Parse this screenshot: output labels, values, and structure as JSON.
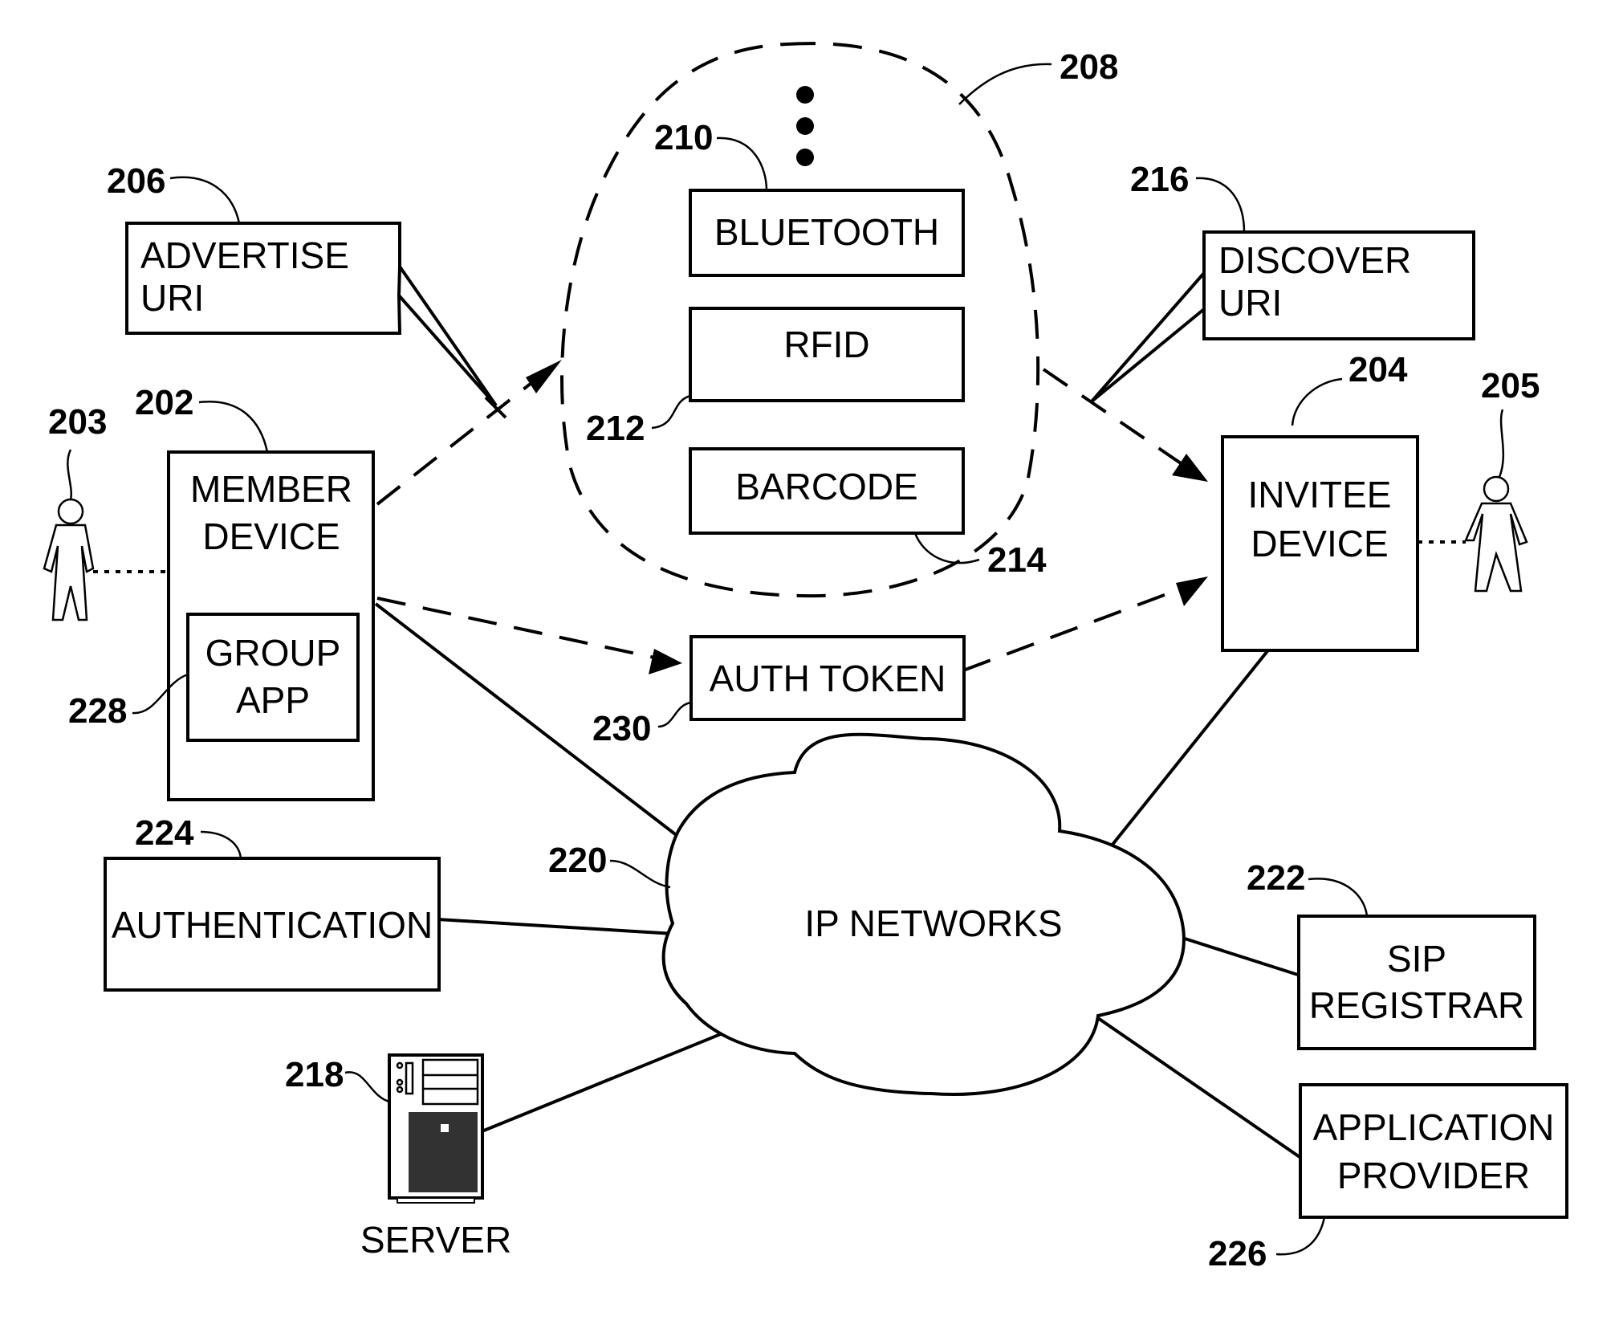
{
  "diagram": {
    "member_device": {
      "ref": "202",
      "line1": "MEMBER",
      "line2": "DEVICE"
    },
    "group_app": {
      "ref": "228",
      "line1": "GROUP",
      "line2": "APP"
    },
    "member_user": {
      "ref": "203",
      "icon": "person-icon"
    },
    "invitee_device": {
      "ref": "204",
      "line1": "INVITEE",
      "line2": "DEVICE"
    },
    "invitee_user": {
      "ref": "205",
      "icon": "person-icon"
    },
    "advertise": {
      "ref": "206",
      "line1": "ADVERTISE",
      "line2": "URI"
    },
    "discover": {
      "ref": "216",
      "line1": "DISCOVER",
      "line2": "URI"
    },
    "channels": {
      "ref": "208",
      "ellipsis": "more-channels-icon"
    },
    "bluetooth": {
      "ref": "210",
      "label": "BLUETOOTH"
    },
    "rfid": {
      "ref": "212",
      "label": "RFID"
    },
    "barcode": {
      "ref": "214",
      "label": "BARCODE"
    },
    "auth_token": {
      "ref": "230",
      "label": "AUTH TOKEN"
    },
    "ip_networks": {
      "ref": "220",
      "label": "IP NETWORKS"
    },
    "authentication": {
      "ref": "224",
      "label": "AUTHENTICATION"
    },
    "server": {
      "ref": "218",
      "label": "SERVER",
      "icon": "server-icon"
    },
    "sip_registrar": {
      "ref": "222",
      "line1": "SIP",
      "line2": "REGISTRAR"
    },
    "app_provider": {
      "ref": "226",
      "line1": "APPLICATION",
      "line2": "PROVIDER"
    }
  }
}
